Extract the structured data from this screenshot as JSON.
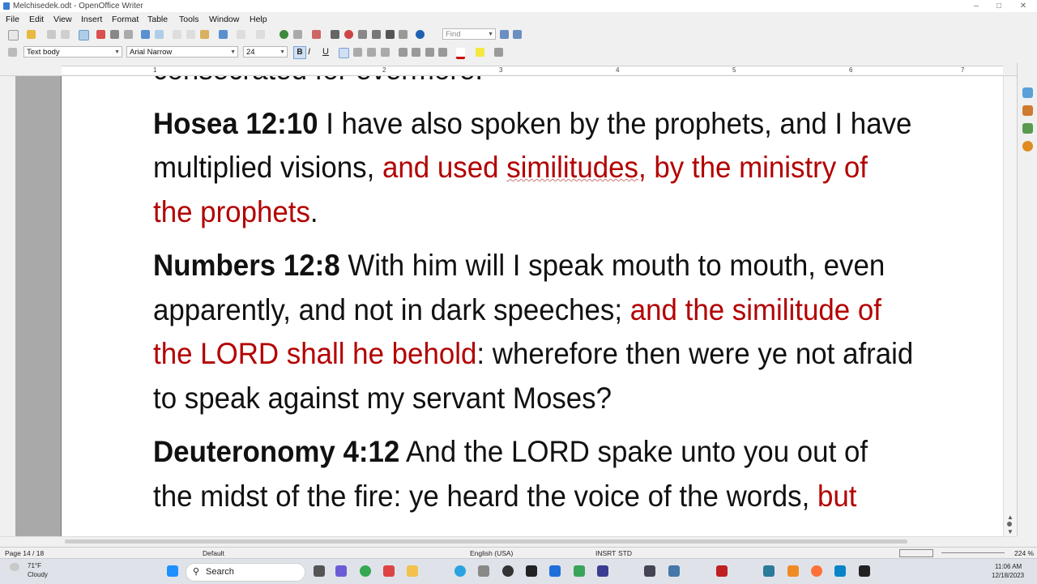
{
  "window": {
    "title": "Melchisedek.odt - OpenOffice Writer"
  },
  "menu": [
    "File",
    "Edit",
    "View",
    "Insert",
    "Format",
    "Table",
    "Tools",
    "Window",
    "Help"
  ],
  "toolbar": {
    "find_placeholder": "Find"
  },
  "format": {
    "style": "Text body",
    "font": "Arial Narrow",
    "size": "24",
    "bold": "B",
    "italic": "I",
    "underline": "U"
  },
  "ruler": {
    "ticks": [
      "1",
      "2",
      "3",
      "4",
      "5",
      "6",
      "7"
    ]
  },
  "document": {
    "partial_line": "consecrated for evermore.",
    "verses": [
      {
        "ref": "Hosea 12:10",
        "segments": [
          {
            "text": " I have also spoken by the prophets, and I have multiplied visions, ",
            "red": false
          },
          {
            "text": "and used ",
            "red": true
          },
          {
            "text": "similitudes",
            "red": true,
            "underline": true
          },
          {
            "text": ", by the ministry of the prophets",
            "red": true
          },
          {
            "text": ".",
            "red": false
          }
        ]
      },
      {
        "ref": "Numbers 12:8",
        "segments": [
          {
            "text": " With him will I speak mouth to mouth, even apparently, and not in dark speeches; ",
            "red": false
          },
          {
            "text": "and the similitude of the LORD shall he behold",
            "red": true
          },
          {
            "text": ": wherefore then were ye not afraid to speak against my servant Moses?",
            "red": false
          }
        ]
      },
      {
        "ref": "Deuteronomy 4:12",
        "segments": [
          {
            "text": " And the LORD spake unto you out of the midst of the fire: ye heard the voice of the words, ",
            "red": false
          },
          {
            "text": "but",
            "red": true
          }
        ]
      }
    ]
  },
  "status": {
    "page": "Page 14 / 18",
    "style": "Default",
    "language": "English (USA)",
    "insert": "INSRT",
    "selection": "STD",
    "zoom": "224 %"
  },
  "taskbar": {
    "weather_temp": "71°F",
    "weather_desc": "Cloudy",
    "search": "Search",
    "time": "11:06 AM",
    "date": "12/18/2023"
  },
  "colors": {
    "verse_red": "#b30000",
    "page_bg": "#ffffff",
    "margin_gray": "#a9a9a9"
  }
}
